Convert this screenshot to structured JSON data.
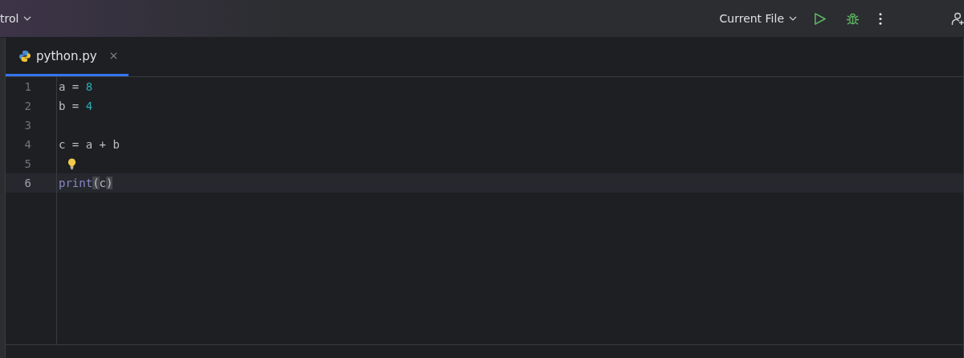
{
  "toolbar": {
    "project_menu": "trol",
    "run_config": "Current File"
  },
  "tabs": [
    {
      "label": "python.py",
      "selected": true
    }
  ],
  "lines": [
    {
      "number": "1",
      "current": false,
      "bulb": false,
      "tokens": [
        {
          "text": "a = ",
          "kind": "plain"
        },
        {
          "text": "8",
          "kind": "number"
        }
      ]
    },
    {
      "number": "2",
      "current": false,
      "bulb": false,
      "tokens": [
        {
          "text": "b = ",
          "kind": "plain"
        },
        {
          "text": "4",
          "kind": "number"
        }
      ]
    },
    {
      "number": "3",
      "current": false,
      "bulb": false
    },
    {
      "number": "4",
      "current": false,
      "bulb": false,
      "tokens": [
        {
          "text": "c = a + b",
          "kind": "plain"
        }
      ]
    },
    {
      "number": "5",
      "current": false,
      "bulb": true
    },
    {
      "number": "6",
      "current": true,
      "bulb": false,
      "tokens": [
        {
          "text": "print",
          "kind": "builtin"
        },
        {
          "text": "(",
          "kind": "brace"
        },
        {
          "text": "c",
          "kind": "plain"
        },
        {
          "text": ")",
          "kind": "brace"
        }
      ]
    }
  ]
}
